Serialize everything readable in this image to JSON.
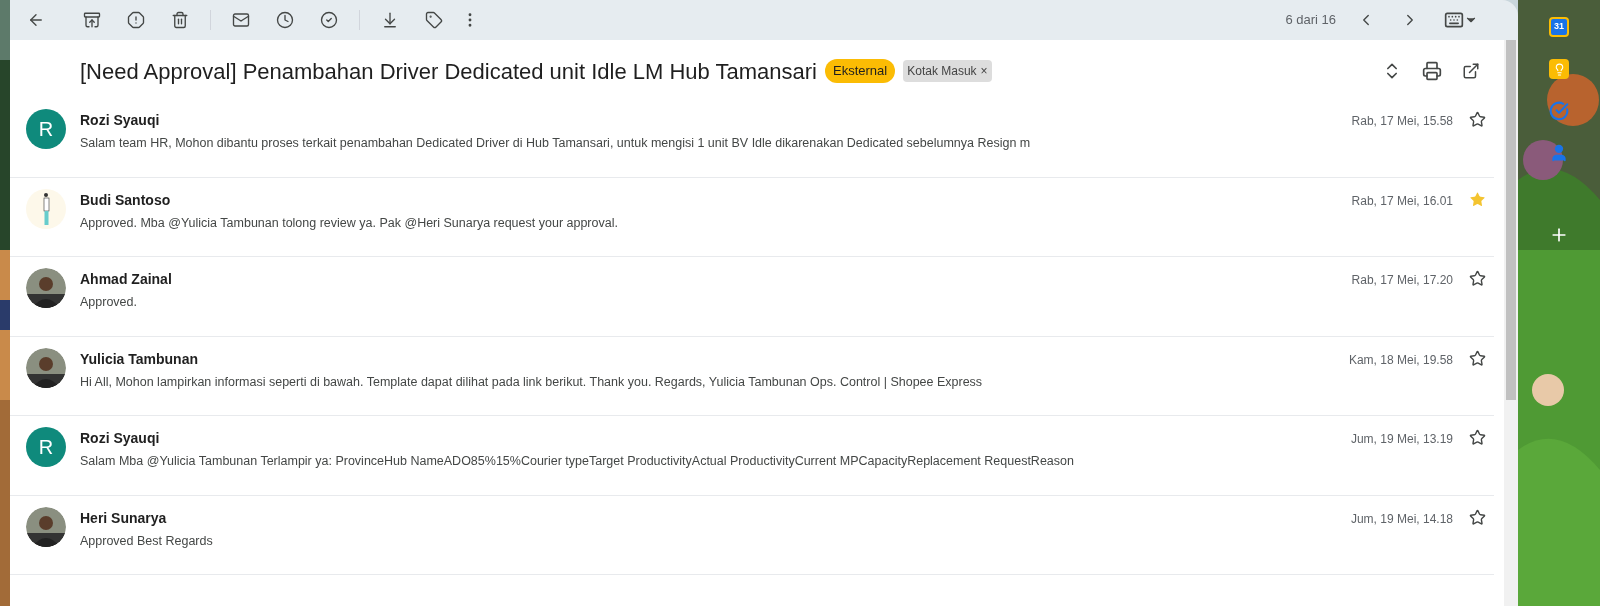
{
  "toolbar": {
    "counter": "6 dari 16"
  },
  "subject": "[Need Approval] Penambahan Driver Dedicated unit Idle LM Hub Tamansari",
  "labels": [
    {
      "kind": "external",
      "text": "Eksternal"
    },
    {
      "kind": "removable",
      "text": "Kotak Masuk",
      "remove": "×"
    }
  ],
  "messages": [
    {
      "sender": "Rozi Syauqi",
      "snippet": "Salam team HR, Mohon dibantu proses terkait penambahan Dedicated Driver di Hub Tamansari, untuk mengisi 1 unit BV Idle dikarenakan Dedicated sebelumnya Resign m",
      "date": "Rab, 17 Mei, 15.58",
      "starred": false,
      "avatar": {
        "kind": "letter",
        "letter": "R",
        "color": "#0f8a7c"
      }
    },
    {
      "sender": "Budi Santoso",
      "snippet": "Approved. Mba @Yulicia Tambunan tolong review ya. Pak @Heri Sunarya request your approval.",
      "date": "Rab, 17 Mei, 16.01",
      "starred": true,
      "avatar": {
        "kind": "illustration"
      }
    },
    {
      "sender": "Ahmad Zainal",
      "snippet": "Approved.",
      "date": "Rab, 17 Mei, 17.20",
      "starred": false
    },
    {
      "sender": "Yulicia Tambunan",
      "snippet": "Hi All, Mohon lampirkan informasi seperti di bawah. Template dapat dilihat pada link berikut. Thank you. Regards, Yulicia Tambunan Ops. Control | Shopee Express",
      "date": "Kam, 18 Mei, 19.58",
      "starred": false
    },
    {
      "sender": "Rozi Syauqi",
      "snippet": "Salam Mba @Yulicia Tambunan Terlampir ya: ProvinceHub NameADO85%15%Courier typeTarget ProductivityActual ProductivityCurrent MPCapacityReplacement RequestReason",
      "date": "Jum, 19 Mei, 13.19",
      "starred": false,
      "avatar": {
        "kind": "letter",
        "letter": "R",
        "color": "#0f8a7c"
      }
    },
    {
      "sender": "Heri Sunarya",
      "snippet": "Approved Best Regards",
      "date": "Jum, 19 Mei, 14.18",
      "starred": false
    }
  ],
  "side_apps": [
    {
      "kind": "calendar",
      "text": "31"
    },
    {
      "kind": "keep"
    },
    {
      "kind": "tasks"
    },
    {
      "kind": "contacts"
    },
    {
      "kind": "add"
    }
  ]
}
